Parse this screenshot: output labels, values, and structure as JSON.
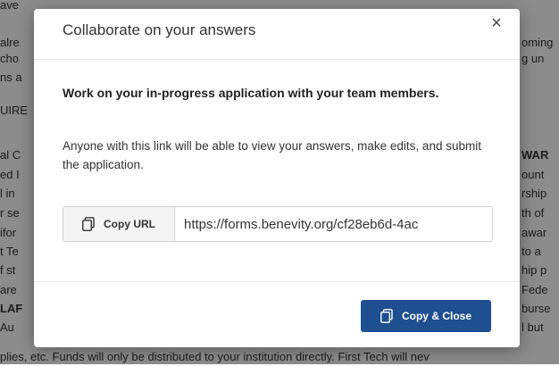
{
  "background": {
    "lines": [
      "ave",
      "alre",
      "cho",
      "ns a",
      "UIRE",
      "al C",
      "ed I",
      "l in",
      "r se",
      "ifor",
      "t Te",
      "f st",
      "are",
      "LAF",
      "Au",
      "plies, etc. Funds will only be distributed to your institution directly. First Tech will nev"
    ],
    "right_lines": [
      "oming",
      "g un",
      "WAR",
      "ount",
      "rship",
      "th of",
      "awar",
      "to a",
      "hip p",
      "Fede",
      "burse",
      "l but"
    ]
  },
  "modal": {
    "title": "Collaborate on your answers",
    "close_label": "×",
    "heading": "Work on your in-progress application with your team members.",
    "description": "Anyone with this link will be able to view your answers, make edits, and submit the application.",
    "copy_url_label": "Copy URL",
    "url_value": "https://forms.benevity.org/cf28eb6d-4ac",
    "copy_close_label": "Copy & Close",
    "icon_copy": "clipboard-icon",
    "accent_color": "#1d4f91"
  }
}
